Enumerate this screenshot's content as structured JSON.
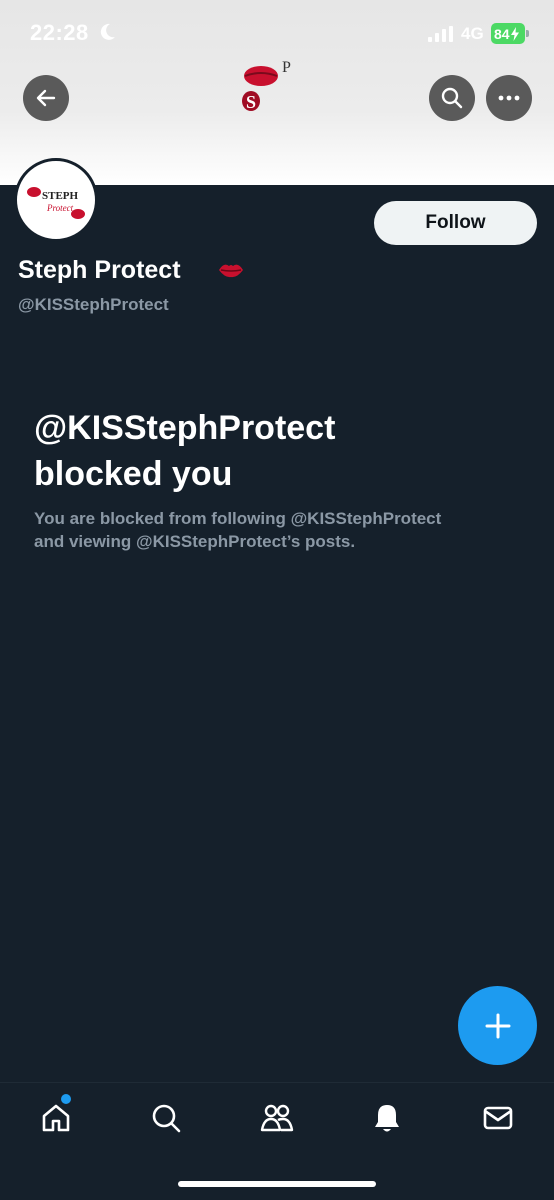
{
  "status_bar": {
    "time": "22:28",
    "network": "4G",
    "battery": "84"
  },
  "profile": {
    "display_name": "Steph Protect",
    "handle": "@KISStephProtect",
    "follow_label": "Follow"
  },
  "blocked": {
    "title_line1": "@KISStephProtect",
    "title_line2": "blocked you",
    "desc_line1": "You are blocked from following @KISStephProtect",
    "desc_line2": "and viewing @KISStephProtect’s posts."
  },
  "avatar_logo": {
    "line1": "STEPH",
    "line2": "Protect"
  },
  "banner_logo": {
    "letter_s": "S",
    "letter_p": "P"
  },
  "icons": {
    "back": "arrow-left-icon",
    "search": "search-icon",
    "more": "more-icon",
    "compose": "plus-icon",
    "home": "home-icon",
    "explore": "search-icon",
    "communities": "people-icon",
    "notifications": "bell-icon",
    "messages": "mail-icon"
  },
  "colors": {
    "background": "#15202b",
    "accent": "#1d9bf0",
    "secondary_text": "#8b98a5",
    "battery": "#4cd964",
    "lips": "#c8102e"
  }
}
